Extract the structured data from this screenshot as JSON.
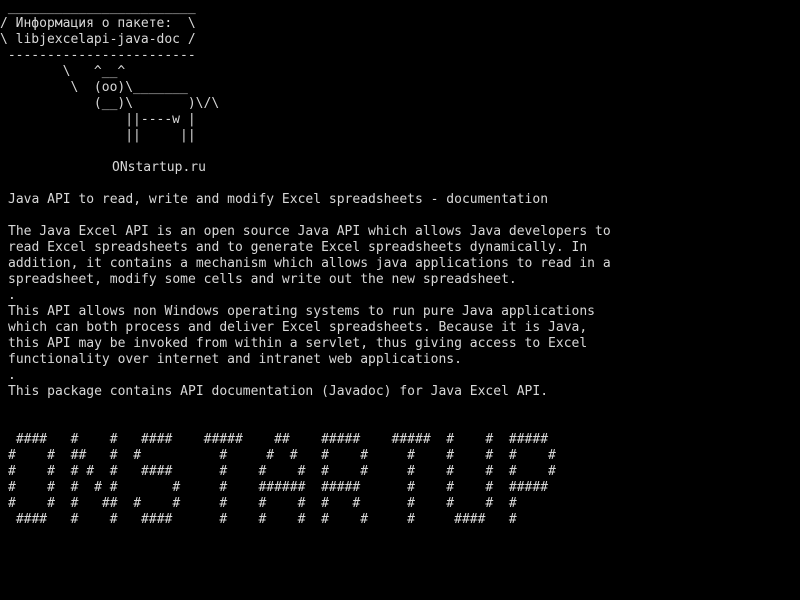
{
  "terminal": {
    "background_color": "#000000",
    "text_color": "#d8d8d8",
    "cowsay": {
      "bubble_top": " ________________________",
      "bubble_line1": "/ Информация о пакете:  \\",
      "bubble_line2": "\\ libjexcelapi-java-doc /",
      "bubble_bottom": " ------------------------",
      "cow_line1": "        \\   ^__^",
      "cow_line2": "         \\  (oo)\\_______",
      "cow_line3": "            (__)\\       )\\/\\",
      "cow_line4": "                ||----w |",
      "cow_line5": "                ||     ||"
    },
    "site_name": "ONstartup.ru",
    "summary": "Java API to read, write and modify Excel spreadsheets - documentation",
    "description": [
      "The Java Excel API is an open source Java API which allows Java developers to",
      "read Excel spreadsheets and to generate Excel spreadsheets dynamically. In",
      "addition, it contains a mechanism which allows java applications to read in a",
      "spreadsheet, modify some cells and write out the new spreadsheet.",
      ".",
      "This API allows non Windows operating systems to run pure Java applications",
      "which can both process and deliver Excel spreadsheets. Because it is Java,",
      "this API may be invoked from within a servlet, thus giving access to Excel",
      "functionality over internet and intranet web applications.",
      ".",
      "This package contains API documentation (Javadoc) for Java Excel API."
    ],
    "banner": [
      " ####   #    #   ####    #####    ##    #####    #####  #    #  #####",
      "#    #  ##   #  #          #     #  #   #    #     #    #    #  #    #",
      "#    #  # #  #   ####      #    #    #  #    #     #    #    #  #    #",
      "#    #  #  # #       #     #    ######  #####      #    #    #  #####",
      "#    #  #   ##  #    #     #    #    #  #   #      #    #    #  #",
      " ####   #    #   ####      #    #    #  #    #     #     ####   #"
    ]
  }
}
